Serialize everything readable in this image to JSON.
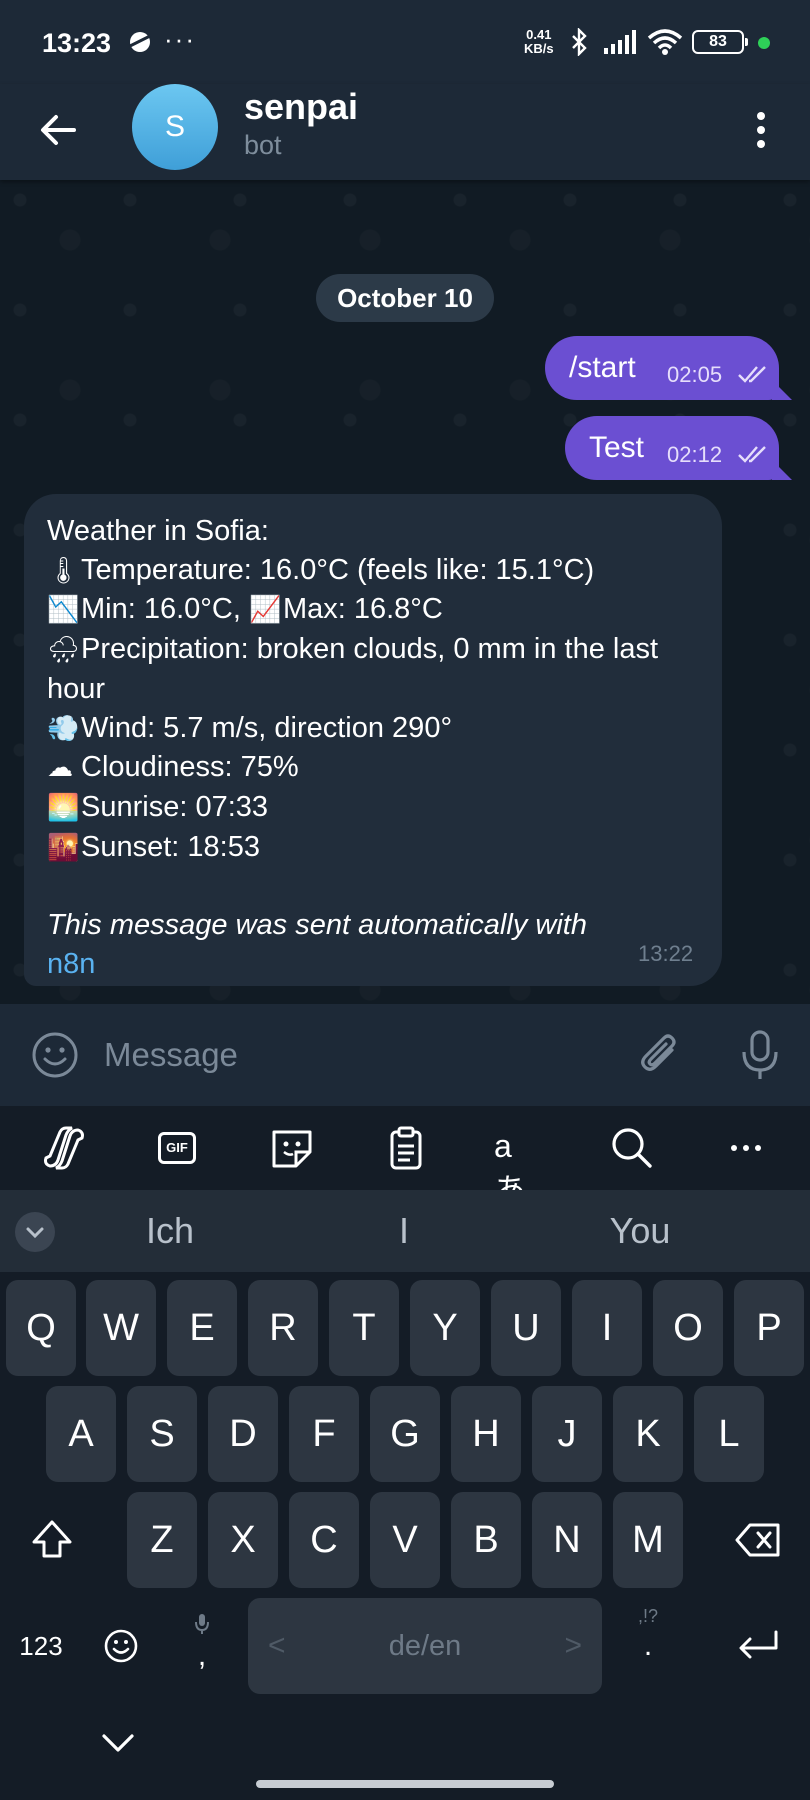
{
  "status_bar": {
    "time": "13:23",
    "more": "···",
    "speed_value": "0.41",
    "speed_unit": "KB/s",
    "battery": "83",
    "icons": [
      "planet-icon",
      "bluetooth-icon",
      "signal-icon",
      "wifi-icon",
      "battery-icon",
      "green-dot-icon"
    ]
  },
  "header": {
    "avatar_letter": "S",
    "title": "senpai",
    "subtitle": "bot",
    "icons": [
      "back-arrow-icon",
      "more-vertical-icon"
    ]
  },
  "chat": {
    "date_chip": "October 10",
    "outgoing": [
      {
        "text": "/start",
        "time": "02:05"
      },
      {
        "text": "Test",
        "time": "02:12"
      }
    ],
    "incoming": {
      "lines": [
        {
          "emoji": "",
          "text": "Weather in Sofia:"
        },
        {
          "emoji": "🌡",
          "text": "Temperature: 16.0°C (feels like: 15.1°C)"
        },
        {
          "emoji": "📉",
          "text": "Min: 16.0°C,"
        },
        {
          "emoji": "📈",
          "text": "Max: 16.8°C"
        },
        {
          "emoji": "🌧",
          "text": "Precipitation: broken clouds, 0 mm in the last hour"
        },
        {
          "emoji": "💨",
          "text": "Wind: 5.7 m/s, direction 290°"
        },
        {
          "emoji": "☁",
          "text": "Cloudiness: 75%"
        },
        {
          "emoji": "🌅",
          "text": "Sunrise: 07:33"
        },
        {
          "emoji": "🌇",
          "text": "Sunset: 18:53"
        }
      ],
      "footer_text": "This message was sent automatically with",
      "footer_link": "n8n",
      "time": "13:22"
    }
  },
  "composer": {
    "placeholder": "Message",
    "icons": [
      "emoji-icon",
      "paperclip-icon",
      "microphone-icon"
    ]
  },
  "keyboard": {
    "toolbar_icons": [
      "copilot-icon",
      "gif-icon",
      "sticker-icon",
      "clipboard-icon",
      "translate-icon",
      "search-icon",
      "more-horizontal-icon"
    ],
    "gif_label": "GIF",
    "translate_label": "aあ",
    "suggestions": [
      "Ich",
      "I",
      "You"
    ],
    "row1": [
      "Q",
      "W",
      "E",
      "R",
      "T",
      "Y",
      "U",
      "I",
      "O",
      "P"
    ],
    "row2": [
      "A",
      "S",
      "D",
      "F",
      "G",
      "H",
      "J",
      "K",
      "L"
    ],
    "row3": [
      "Z",
      "X",
      "C",
      "V",
      "B",
      "N",
      "M"
    ],
    "numbers_key": "123",
    "comma_key": ",",
    "space_label": "de/en",
    "period_key": ".",
    "punct_hint": ",!?",
    "space_left": "<",
    "space_right": ">"
  }
}
